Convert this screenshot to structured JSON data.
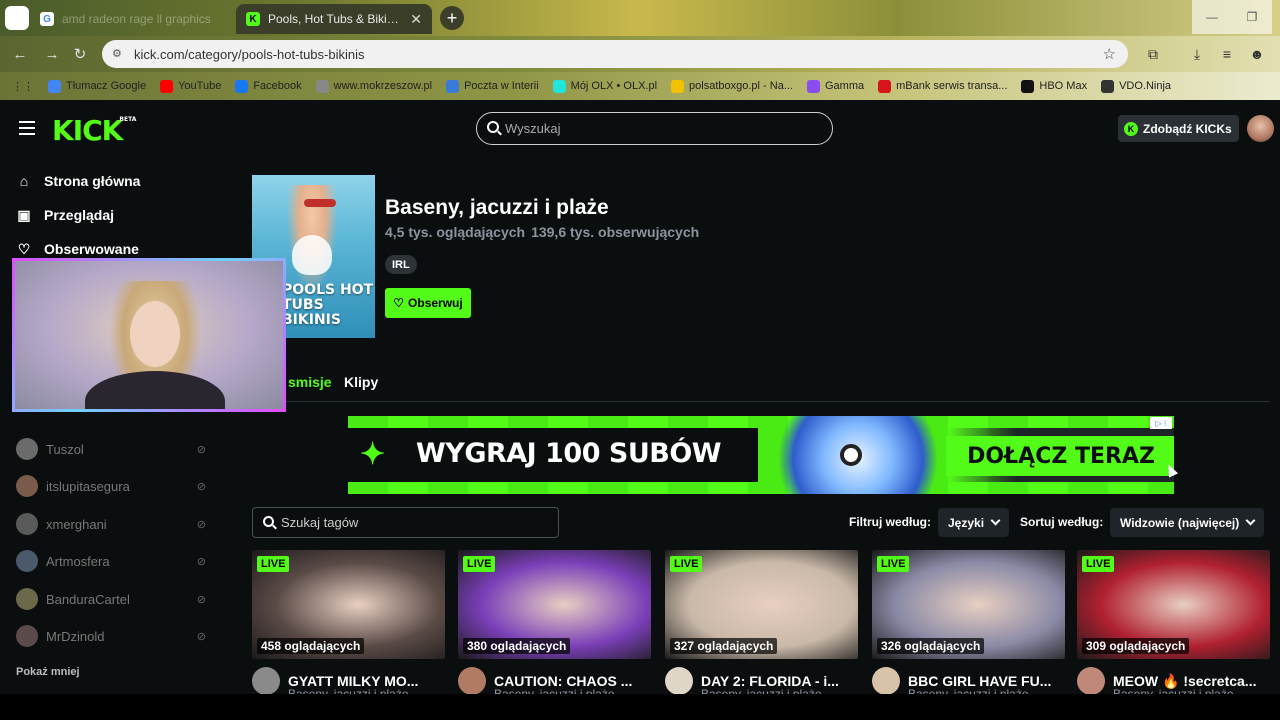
{
  "browser": {
    "tabs": [
      {
        "title": "amd radeon rage ll graphics",
        "active": false
      },
      {
        "title": "Pools, Hot Tubs & Bikinis Stream",
        "active": true
      }
    ],
    "url": "kick.com/category/pools-hot-tubs-bikinis",
    "bookmarks": [
      {
        "label": "Tłumacz Google",
        "color": "#4285f4"
      },
      {
        "label": "YouTube",
        "color": "#ff0000"
      },
      {
        "label": "Facebook",
        "color": "#1877f2"
      },
      {
        "label": "www.mokrzeszow.pl",
        "color": "#888888"
      },
      {
        "label": "Poczta w Interii",
        "color": "#3a7ad9"
      },
      {
        "label": "Mój OLX • OLX.pl",
        "color": "#23e5db"
      },
      {
        "label": "polsatboxgo.pl - Na...",
        "color": "#f2c200"
      },
      {
        "label": "Gamma",
        "color": "#8a4df0"
      },
      {
        "label": "mBank serwis transa...",
        "color": "#d7141a"
      },
      {
        "label": "HBO Max",
        "color": "#111111"
      },
      {
        "label": "VDO.Ninja",
        "color": "#333333"
      }
    ]
  },
  "header": {
    "logo": "KICK",
    "logo_badge": "BETA",
    "search_placeholder": "Wyszukaj",
    "kicks_button": "Zdobądź KICKs"
  },
  "sidebar": {
    "nav": [
      {
        "label": "Strona główna",
        "icon": "home-icon"
      },
      {
        "label": "Przeglądaj",
        "icon": "browse-icon"
      },
      {
        "label": "Obserwowane",
        "icon": "heart-icon"
      }
    ],
    "following": [
      {
        "name": "Tuszol",
        "color": "#6b6b6b"
      },
      {
        "name": "itslupitasegura",
        "color": "#7a5a4a"
      },
      {
        "name": "xmerghani",
        "color": "#5a5a5a"
      },
      {
        "name": "Artmosfera",
        "color": "#4a5a6a"
      },
      {
        "name": "BanduraCartel",
        "color": "#6a6a4a"
      },
      {
        "name": "MrDzinold",
        "color": "#5a4a4a"
      }
    ],
    "show_less": "Pokaż mniej"
  },
  "category": {
    "title": "Baseny, jacuzzi i plaże",
    "viewers": "4,5 tys. oglądających",
    "followers": "139,6 tys. obserwujących",
    "tag": "IRL",
    "follow_button": "Obserwuj",
    "thumb_text": "POOLS HOT TUBS BIKINIS"
  },
  "tabs": {
    "livestreams": "smisje",
    "clips": "Klipy"
  },
  "banner": {
    "text": "WYGRAJ 100 SUBÓW",
    "cta": "DOŁĄCZ TERAZ"
  },
  "filters": {
    "tag_search_placeholder": "Szukaj tagów",
    "filter_label": "Filtruj według:",
    "filter_value": "Języki",
    "sort_label": "Sortuj według:",
    "sort_value": "Widzowie (najwięcej)"
  },
  "streams": [
    {
      "live": "LIVE",
      "viewers": "458 oglądających",
      "title": "GYATT MILKY MO...",
      "category": "Baseny, jacuzzi i plaże",
      "thumb": "#5a4a46",
      "avatar": "#8a8a8a"
    },
    {
      "live": "LIVE",
      "viewers": "380 oglądających",
      "title": "CAUTION: CHAOS ...",
      "category": "Baseny, jacuzzi i plaże",
      "thumb": "#7a3fb8",
      "avatar": "#b07a64"
    },
    {
      "live": "LIVE",
      "viewers": "327 oglądających",
      "title": "DAY 2: FLORIDA - i...",
      "category": "Baseny, jacuzzi i plaże",
      "thumb": "#c9b8a8",
      "avatar": "#e0d6c8"
    },
    {
      "live": "LIVE",
      "viewers": "326 oglądających",
      "title": "BBC GIRL HAVE FU...",
      "category": "Baseny, jacuzzi i plaże",
      "thumb": "#8a8aa6",
      "avatar": "#d8c2a8"
    },
    {
      "live": "LIVE",
      "viewers": "309 oglądających",
      "title": "MEOW 🔥 !secretca...",
      "category": "Baseny, jacuzzi i plaże",
      "thumb": "#b02030",
      "avatar": "#c08878"
    }
  ]
}
